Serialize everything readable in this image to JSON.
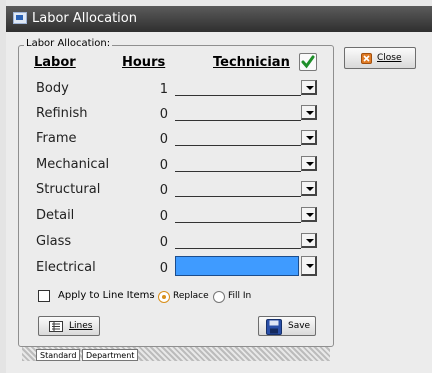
{
  "window": {
    "title": "Labor Allocation"
  },
  "group": {
    "label": "Labor Allocation:"
  },
  "headers": {
    "labor": "Labor",
    "hours": "Hours",
    "technician": "Technician"
  },
  "rows": [
    {
      "label": "Body",
      "hours": "1",
      "technician": ""
    },
    {
      "label": "Refinish",
      "hours": "0",
      "technician": ""
    },
    {
      "label": "Frame",
      "hours": "0",
      "technician": ""
    },
    {
      "label": "Mechanical",
      "hours": "0",
      "technician": ""
    },
    {
      "label": "Structural",
      "hours": "0",
      "technician": ""
    },
    {
      "label": "Detail",
      "hours": "0",
      "technician": ""
    },
    {
      "label": "Glass",
      "hours": "0",
      "technician": ""
    },
    {
      "label": "Electrical",
      "hours": "0",
      "technician": ""
    }
  ],
  "options": {
    "apply_label": "Apply to Line Items",
    "replace_label": "Replace",
    "fillin_label": "Fill In",
    "selected": "Replace"
  },
  "buttons": {
    "close": "Close",
    "lines": "Lines",
    "save": "Save"
  },
  "tabs": [
    "Standard",
    "Department"
  ],
  "colors": {
    "selected_field": "#3f9bff",
    "check_icon": "#1f8f2a",
    "close_icon": "#e07b25",
    "save_icon": "#2a4fa8"
  }
}
